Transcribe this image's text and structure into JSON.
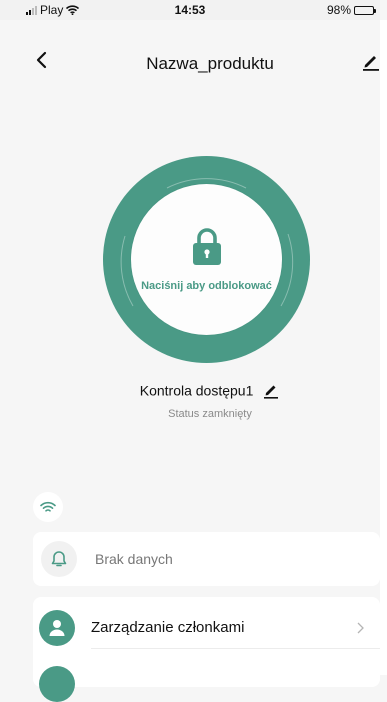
{
  "status_bar": {
    "carrier": "Play",
    "time": "14:53",
    "battery": "98%",
    "battery_level": 0.98
  },
  "nav": {
    "title": "Nazwa_produktu"
  },
  "lock": {
    "action_label": "Naciśnij aby odblokować",
    "device_name": "Kontrola dostępu1",
    "status": "Status zamknięty"
  },
  "events": {
    "empty_text": "Brak danych"
  },
  "menu": {
    "items": [
      {
        "label": "Zarządzanie członkami"
      }
    ]
  },
  "colors": {
    "accent": "#4a9a86",
    "background": "#f6f6f6",
    "card": "#ffffff"
  },
  "icons": {
    "back": "chevron-left-icon",
    "edit": "pencil-icon",
    "lock": "padlock-icon",
    "wifi": "wifi-icon",
    "bell": "bell-icon",
    "member": "person-icon",
    "chevron": "chevron-right-icon"
  }
}
